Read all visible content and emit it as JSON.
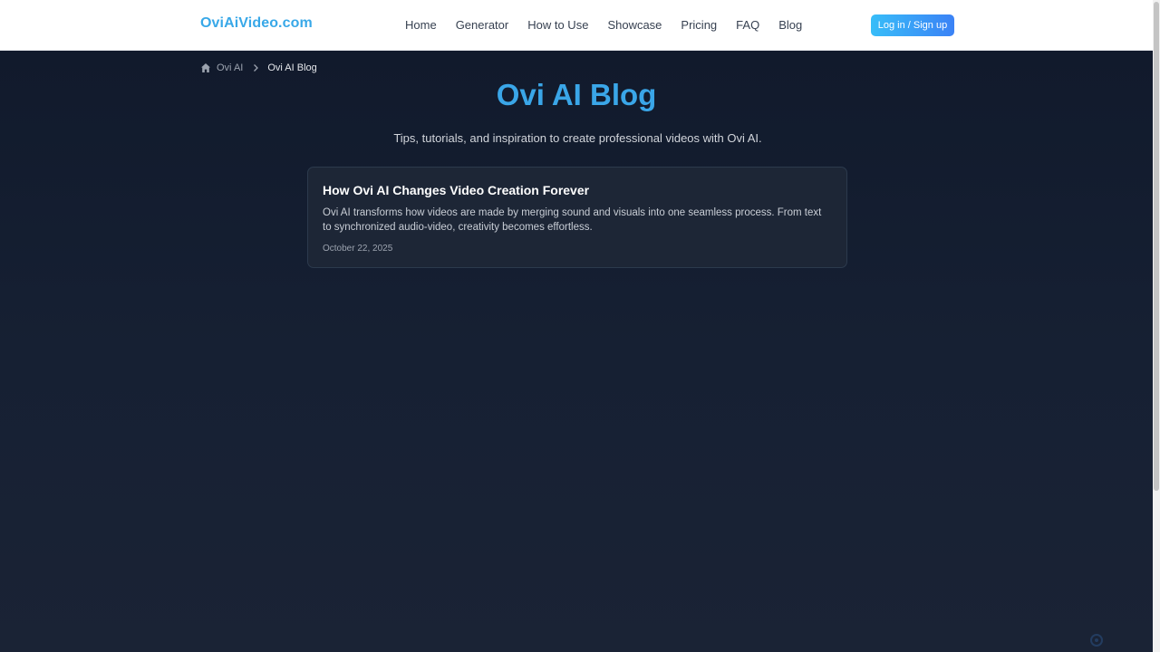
{
  "header": {
    "logo": "OviAiVideo.com",
    "nav": [
      {
        "label": "Home"
      },
      {
        "label": "Generator"
      },
      {
        "label": "How to Use"
      },
      {
        "label": "Showcase"
      },
      {
        "label": "Pricing"
      },
      {
        "label": "FAQ"
      },
      {
        "label": "Blog"
      }
    ],
    "login_label": "Log in / Sign up"
  },
  "breadcrumb": {
    "home_icon": "home-icon",
    "root": "Ovi AI",
    "separator_icon": "chevron-right-icon",
    "current": "Ovi AI Blog"
  },
  "main": {
    "title": "Ovi AI Blog",
    "subtitle": "Tips, tutorials, and inspiration to create professional videos with Ovi AI."
  },
  "posts": [
    {
      "title": "How Ovi AI Changes Video Creation Forever",
      "excerpt": "Ovi AI transforms how videos are made by merging sound and visuals into one seamless process. From text to synchronized audio-video, creativity becomes effortless.",
      "date": "October 22, 2025"
    }
  ],
  "colors": {
    "brand": "#38a8e8",
    "title": "#3aa6e8",
    "background": "#111a2c",
    "card": "#1d2636",
    "button_start": "#38bdf8",
    "button_end": "#3b82f6"
  }
}
